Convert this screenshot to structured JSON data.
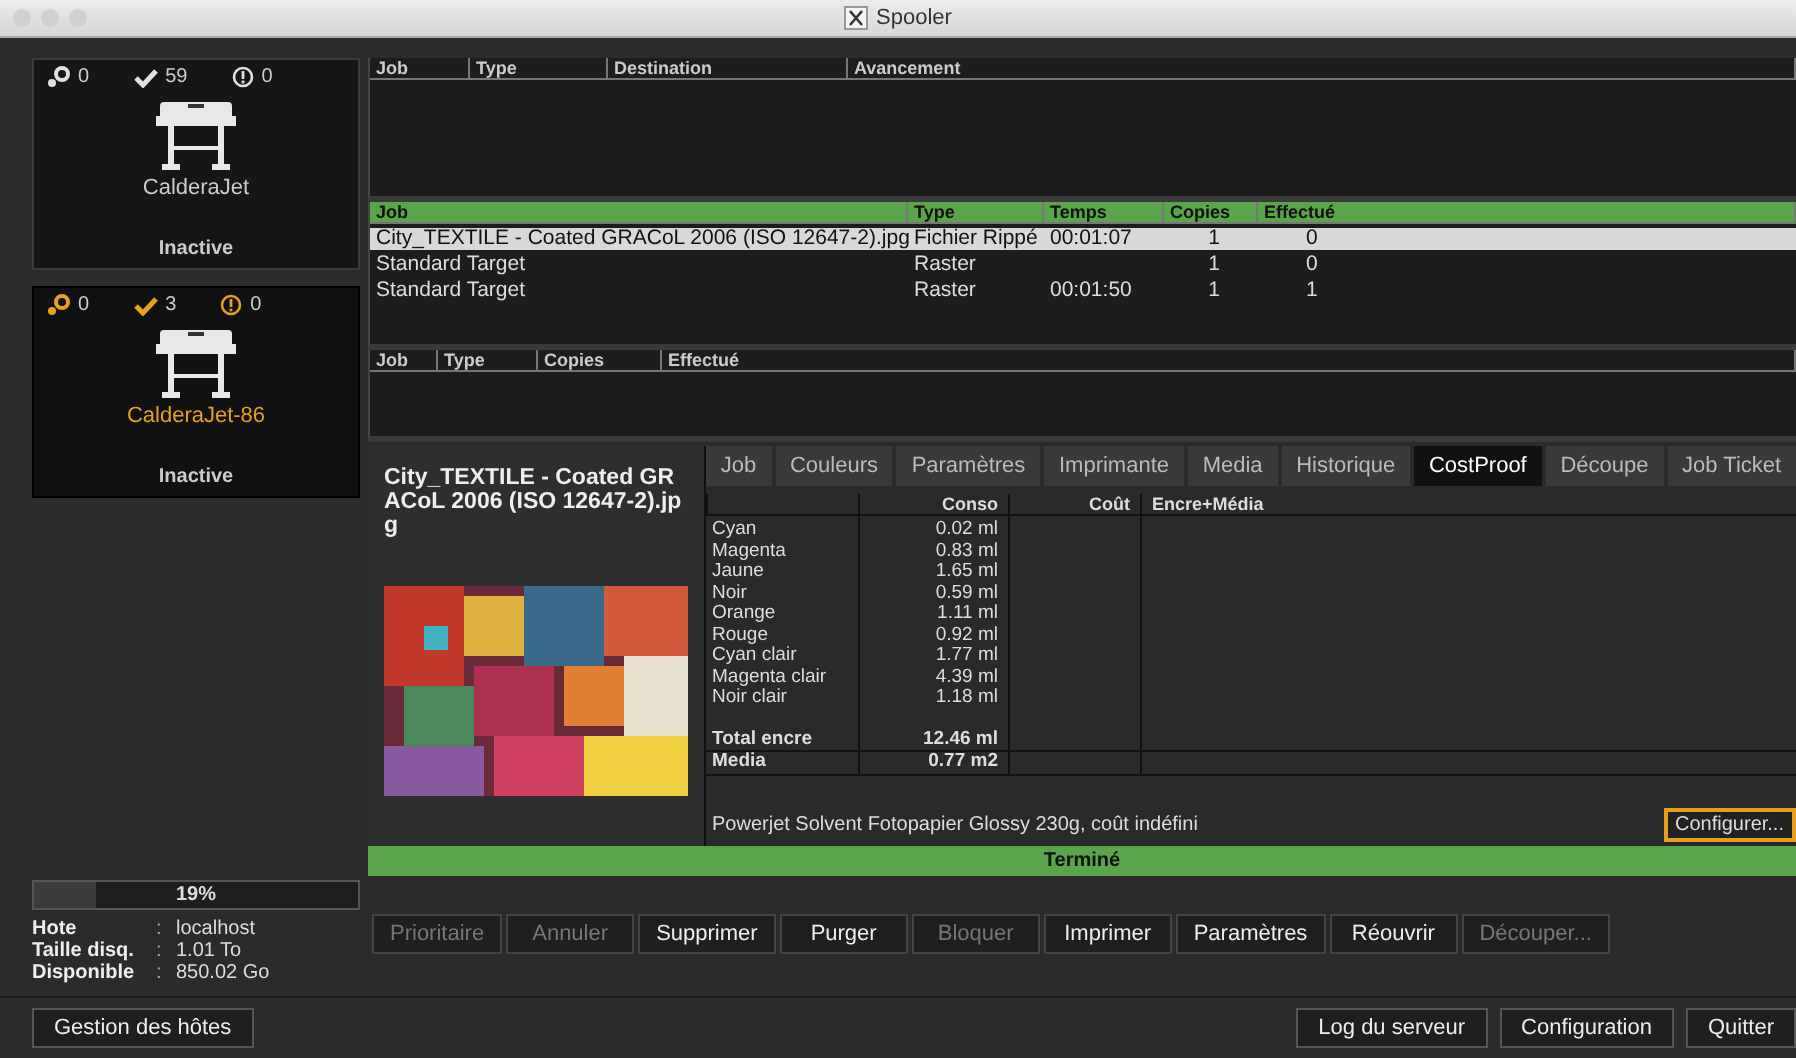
{
  "window": {
    "title": "Spooler"
  },
  "printers": [
    {
      "name": "CalderaJet",
      "status": "Inactive",
      "selected": false,
      "counts": [
        "0",
        "59",
        "0"
      ]
    },
    {
      "name": "CalderaJet-86",
      "status": "Inactive",
      "selected": true,
      "counts": [
        "0",
        "3",
        "0"
      ]
    }
  ],
  "disk": {
    "level": 0.19,
    "label": "19%"
  },
  "host_info": [
    {
      "label": "Hote",
      "separator": ":",
      "value": "localhost"
    },
    {
      "label": "Taille disq.",
      "separator": ":",
      "value": "1.01 To"
    },
    {
      "label": "Disponible",
      "separator": ":",
      "value": "850.02 Go"
    }
  ],
  "queue_table": {
    "columns": [
      "Job",
      "Type",
      "Destination",
      "Avancement"
    ]
  },
  "jobs_table": {
    "columns": [
      "Job",
      "Type",
      "Temps",
      "Copies",
      "Effectué"
    ],
    "rows": [
      {
        "cells": [
          "City_TEXTILE - Coated GRACoL 2006 (ISO 12647-2).jpg",
          "Fichier Rippé",
          "00:01:07",
          "1",
          "0"
        ],
        "selected": true
      },
      {
        "cells": [
          "Standard Target",
          "Raster",
          "",
          "1",
          "0"
        ],
        "selected": false
      },
      {
        "cells": [
          "Standard Target",
          "Raster",
          "00:01:50",
          "1",
          "1"
        ],
        "selected": false
      }
    ]
  },
  "done_table": {
    "columns": [
      "Job",
      "Type",
      "Copies",
      "Effectué"
    ]
  },
  "job_detail": {
    "title": "City_TEXTILE - Coated GRACoL 2006 (ISO 12647-2).jpg",
    "tabs": [
      {
        "label": "Job",
        "selected": false
      },
      {
        "label": "Couleurs",
        "selected": false
      },
      {
        "label": "Paramètres",
        "selected": false
      },
      {
        "label": "Imprimante",
        "selected": false
      },
      {
        "label": "Media",
        "selected": false
      },
      {
        "label": "Historique",
        "selected": false
      },
      {
        "label": "CostProof",
        "selected": true
      },
      {
        "label": "Découpe",
        "selected": false
      },
      {
        "label": "Job Ticket",
        "selected": false
      }
    ],
    "cost_table": {
      "columns": [
        "Conso",
        "Coût",
        "Encre+Média"
      ],
      "ink_rows": [
        {
          "label": "Cyan",
          "conso": "0.02 ml"
        },
        {
          "label": "Magenta",
          "conso": "0.83 ml"
        },
        {
          "label": "Jaune",
          "conso": "1.65 ml"
        },
        {
          "label": "Noir",
          "conso": "0.59 ml"
        },
        {
          "label": "Orange",
          "conso": "1.11 ml"
        },
        {
          "label": "Rouge",
          "conso": "0.92 ml"
        },
        {
          "label": "Cyan clair",
          "conso": "1.77 ml"
        },
        {
          "label": "Magenta clair",
          "conso": "4.39 ml"
        },
        {
          "label": "Noir clair",
          "conso": "1.18 ml"
        }
      ],
      "total": {
        "label": "Total encre",
        "conso": "12.46 ml"
      },
      "media": {
        "label": "Media",
        "conso": "0.77 m2"
      }
    },
    "media_note": "Powerjet Solvent Fotopapier Glossy 230g, coût indéfini",
    "configure_button": "Configurer..."
  },
  "status": "Terminé",
  "actions": [
    {
      "label": "Prioritaire",
      "disabled": true
    },
    {
      "label": "Annuler",
      "disabled": true
    },
    {
      "label": "Supprimer",
      "disabled": false
    },
    {
      "label": "Purger",
      "disabled": false
    },
    {
      "label": "Bloquer",
      "disabled": true
    },
    {
      "label": "Imprimer",
      "disabled": false
    },
    {
      "label": "Paramètres",
      "disabled": false
    },
    {
      "label": "Réouvrir",
      "disabled": false
    },
    {
      "label": "Découper...",
      "disabled": true
    }
  ],
  "footer": {
    "left": [
      "Gestion des hôtes"
    ],
    "right": [
      "Log du serveur",
      "Configuration",
      "Quitter"
    ]
  }
}
